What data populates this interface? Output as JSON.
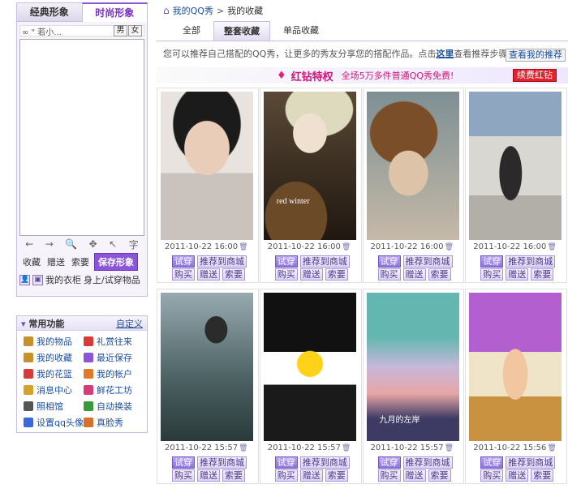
{
  "left": {
    "tabs": {
      "classic": "经典形象",
      "fashion": "时尚形象"
    },
    "name_text": "∞ \" 若小...",
    "sex": {
      "male": "男",
      "female": "女"
    },
    "tools": {
      "back": "←",
      "forward": "→",
      "zoom": "🔍",
      "move": "✥",
      "pointer": "↖",
      "text": "字"
    },
    "actions": {
      "beg": "收藏",
      "gift": "赠送",
      "ask": "索要",
      "save": "保存形象"
    },
    "wardrobe": {
      "closet": "我的衣柜",
      "tryon": "身上/试穿物品"
    },
    "common": {
      "title": "常用功能",
      "customize": "自定义",
      "items": [
        {
          "label": "我的物品",
          "color": "#c8902a"
        },
        {
          "label": "礼赏往来",
          "color": "#d83a3a"
        },
        {
          "label": "我的收藏",
          "color": "#c8902a"
        },
        {
          "label": "最近保存",
          "color": "#8a55d8"
        },
        {
          "label": "我的花篮",
          "color": "#d83a3a"
        },
        {
          "label": "我的帐户",
          "color": "#e07a2a"
        },
        {
          "label": "消息中心",
          "color": "#d8a22a"
        },
        {
          "label": "鲜花工坊",
          "color": "#d83a7a"
        },
        {
          "label": "照相馆",
          "color": "#555555"
        },
        {
          "label": "自动换装",
          "color": "#3a9a3a"
        },
        {
          "label": "设置qq头像",
          "color": "#3a6ad8"
        },
        {
          "label": "真脸秀",
          "color": "#d8702a"
        }
      ]
    }
  },
  "right": {
    "breadcrumb": {
      "home": "我的QQ秀",
      "current": "我的收藏"
    },
    "tabs": [
      "全部",
      "整套收藏",
      "单品收藏"
    ],
    "info_text": "您可以推荐自己搭配的QQ秀，让更多的秀友分享您的搭配作品。点击",
    "info_link": "这里",
    "info_tail": "查看推荐步骤",
    "view_recommend": "查看我的推荐",
    "vip": {
      "title": "红钻特权",
      "subtitle": "全场5万多件普通QQ秀免费!",
      "renew": "续费红钻"
    },
    "button_labels": {
      "try": "试穿",
      "recommend": "推荐到商城",
      "buy": "购买",
      "gift": "赠送",
      "ask": "索要"
    },
    "cards": [
      {
        "date": "2011-10-22 16:00"
      },
      {
        "date": "2011-10-22 16:00",
        "overlay": "red winter"
      },
      {
        "date": "2011-10-22 16:00"
      },
      {
        "date": "2011-10-22 16:00"
      },
      {
        "date": "2011-10-22 15:57"
      },
      {
        "date": "2011-10-22 15:57"
      },
      {
        "date": "2011-10-22 15:57",
        "overlay": "九月的左岸"
      },
      {
        "date": "2011-10-22 15:56"
      }
    ]
  }
}
